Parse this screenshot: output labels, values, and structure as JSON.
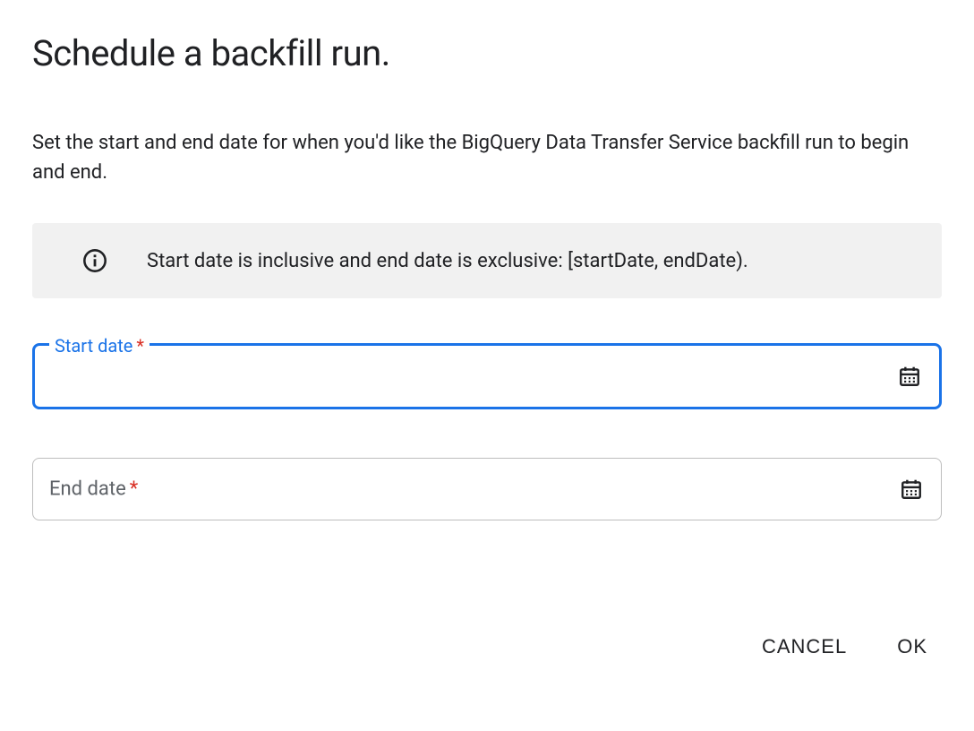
{
  "title": "Schedule a backfill run.",
  "description": "Set the start and end date for when you'd like the BigQuery Data Transfer Service backfill run to begin and end.",
  "info": {
    "text": "Start date is inclusive and end date is exclusive: [startDate, endDate)."
  },
  "fields": {
    "start": {
      "label": "Start date",
      "required": "*",
      "value": ""
    },
    "end": {
      "label": "End date",
      "required": "*",
      "value": ""
    }
  },
  "actions": {
    "cancel": "CANCEL",
    "ok": "OK"
  }
}
